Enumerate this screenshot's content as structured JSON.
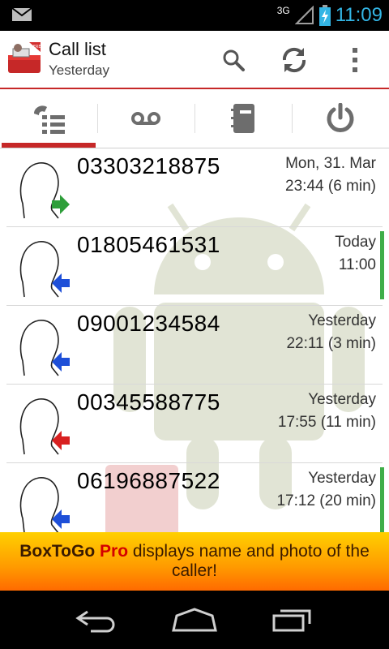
{
  "status_bar": {
    "network": "3G",
    "time": "11:09",
    "clock_color": "#33b5e5"
  },
  "action_bar": {
    "title": "Call list",
    "subtitle": "Yesterday",
    "accent_color": "#c62828",
    "icons": [
      "app-logo-icon",
      "search-icon",
      "refresh-icon",
      "overflow-menu-icon"
    ]
  },
  "tabs": [
    {
      "name": "call-list",
      "icon": "call-list-icon",
      "selected": true
    },
    {
      "name": "voicemail",
      "icon": "voicemail-icon",
      "selected": false
    },
    {
      "name": "contacts",
      "icon": "contacts-book-icon",
      "selected": false
    },
    {
      "name": "power",
      "icon": "power-icon",
      "selected": false
    }
  ],
  "calls": [
    {
      "number": "03303218875",
      "date": "Mon, 31. Mar",
      "time": "23:44 (6 min)",
      "direction": "outgoing",
      "arrow_color": "#2e9e3a",
      "highlight": false
    },
    {
      "number": "01805461531",
      "date": "Today",
      "time": "11:00",
      "direction": "incoming",
      "arrow_color": "#1e4fd8",
      "highlight": true
    },
    {
      "number": "09001234584",
      "date": "Yesterday",
      "time": "22:11 (3 min)",
      "direction": "incoming",
      "arrow_color": "#1e4fd8",
      "highlight": false
    },
    {
      "number": "00345588775",
      "date": "Yesterday",
      "time": "17:55 (11 min)",
      "direction": "missed",
      "arrow_color": "#d82020",
      "highlight": false
    },
    {
      "number": "06196887522",
      "date": "Yesterday",
      "time": "17:12 (20 min)",
      "direction": "incoming",
      "arrow_color": "#1e4fd8",
      "highlight": true
    }
  ],
  "banner": {
    "brand": "BoxToGo",
    "pro": "Pro",
    "text1": "displays name and photo of the",
    "text2": "caller!"
  },
  "nav_bar": {
    "icons": [
      "back-icon",
      "home-icon",
      "recent-apps-icon"
    ]
  }
}
